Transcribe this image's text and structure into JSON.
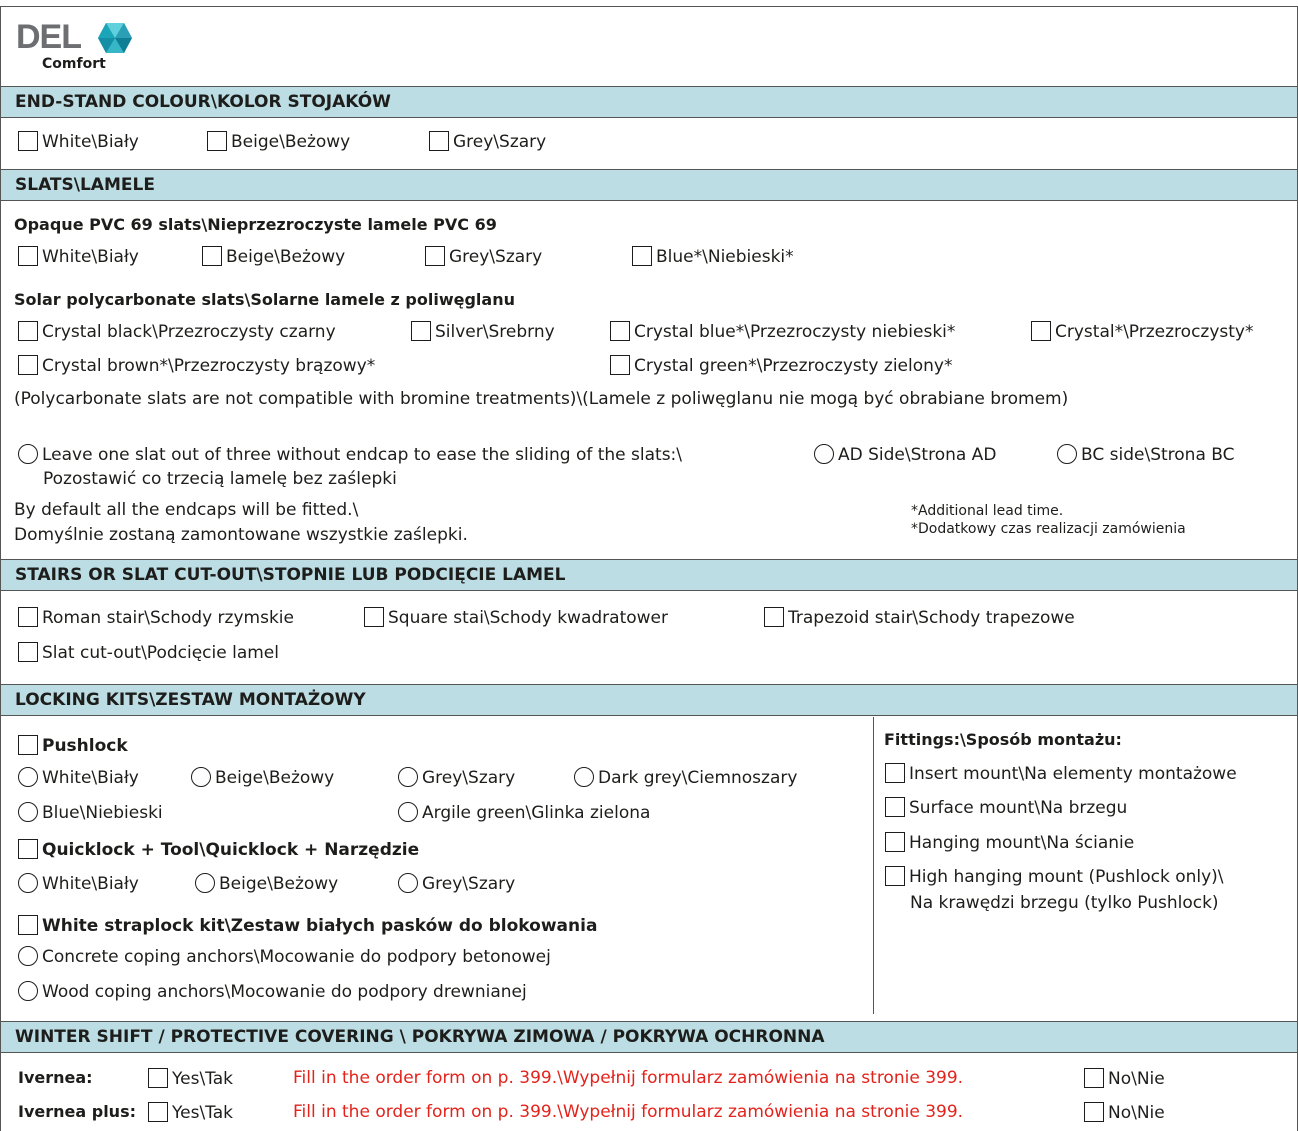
{
  "logo": {
    "brand": "DEL",
    "sub": "Comfort"
  },
  "sections": {
    "endstand": "END-STAND COLOUR\\KOLOR STOJAKÓW",
    "slats": "SLATS\\LAMELE",
    "stairs": "STAIRS OR SLAT CUT-OUT\\STOPNIE LUB PODCIĘCIE LAMEL",
    "locking": "LOCKING KITS\\ZESTAW MONTAŻOWY",
    "winter": "WINTER SHIFT / PROTECTIVE COVERING \\ POKRYWA ZIMOWA / POKRYWA OCHRONNA"
  },
  "endstand": [
    "White\\Biały",
    "Beige\\Beżowy",
    "Grey\\Szary"
  ],
  "opaque": {
    "title": "Opaque PVC 69 slats\\Nieprzezroczyste lamele PVC 69",
    "options": [
      "White\\Biały",
      "Beige\\Beżowy",
      "Grey\\Szary",
      "Blue*\\Niebieski*"
    ]
  },
  "solar": {
    "title": "Solar polycarbonate slats\\Solarne lamele z poliwęglanu",
    "row1": [
      "Crystal black\\Przezroczysty czarny",
      "Silver\\Srebrny",
      "Crystal blue*\\Przezroczysty niebieski*",
      "Crystal*\\Przezroczysty*"
    ],
    "row2": [
      "Crystal brown*\\Przezroczysty brązowy*",
      "Crystal green*\\Przezroczysty zielony*"
    ],
    "note": "(Polycarbonate slats are not compatible with bromine treatments)\\(Lamele z poliwęglanu nie mogą być obrabiane bromem)"
  },
  "endcap": {
    "line1": "Leave one slat out of three without endcap to ease the sliding of the slats:\\",
    "line2": "Pozostawić co trzecią lamelę bez zaślepki",
    "ad": "AD Side\\Strona AD",
    "bc": "BC side\\Strona BC",
    "default1": "By default all the endcaps will be fitted.\\",
    "default2": "Domyślnie zostaną zamontowane wszystkie zaślepki.",
    "lead1": "*Additional lead time.",
    "lead2": "*Dodatkowy czas realizacji zamówienia"
  },
  "stairs": {
    "row1": [
      "Roman stair\\Schody rzymskie",
      "Square stai\\Schody kwadratower",
      "Trapezoid stair\\Schody trapezowe"
    ],
    "row2": [
      "Slat cut-out\\Podcięcie lamel"
    ]
  },
  "locking": {
    "pushlock": "Pushlock",
    "pushlock_row1": [
      "White\\Biały",
      "Beige\\Beżowy",
      "Grey\\Szary",
      "Dark grey\\Ciemnoszary"
    ],
    "pushlock_row2": [
      "Blue\\Niebieski",
      "Argile green\\Glinka zielona"
    ],
    "quicklock": "Quicklock + Tool\\Quicklock + Narzędzie",
    "quicklock_row": [
      "White\\Biały",
      "Beige\\Beżowy",
      "Grey\\Szary"
    ],
    "straplock": "White straplock kit\\Zestaw białych pasków do blokowania",
    "anchors": [
      "Concrete coping anchors\\Mocowanie do podpory betonowej",
      "Wood coping anchors\\Mocowanie do podpory drewnianej"
    ],
    "fittings_title": "Fittings:\\Sposób montażu:",
    "fittings": [
      "Insert mount\\Na elementy montażowe",
      "Surface mount\\Na brzegu",
      "Hanging mount\\Na ścianie",
      "High hanging mount (Pushlock only)\\"
    ],
    "fittings_cont": "Na krawędzi brzegu (tylko Pushlock)"
  },
  "winter": {
    "rows": [
      {
        "label": "Ivernea:",
        "yes": "Yes\\Tak",
        "note": "Fill in the order form on p. 399.\\Wypełnij formularz zamówienia na stronie 399.",
        "no": "No\\Nie"
      },
      {
        "label": "Ivernea plus:",
        "yes": "Yes\\Tak",
        "note": "Fill in the order form on p. 399.\\Wypełnij formularz zamówienia na stronie 399.",
        "no": "No\\Nie"
      }
    ]
  },
  "colors": {
    "band": "#bcdde3",
    "red": "#e3231b",
    "logo_gray": "#6d6e71",
    "gem": "#1aa5b8"
  }
}
